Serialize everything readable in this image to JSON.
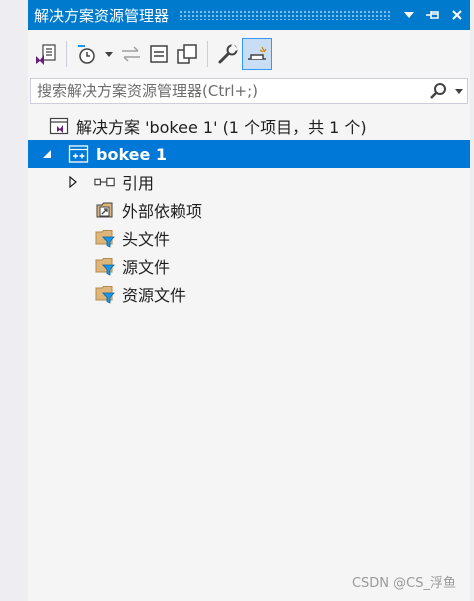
{
  "titlebar": {
    "title": "解决方案资源管理器",
    "dropdown_icon": "chevron-down-icon",
    "pin_icon": "pin-icon",
    "close_icon": "close-icon"
  },
  "toolbar": {
    "icons": [
      "vs-solution-switch-icon",
      "history-icon",
      "history-dropdown-icon",
      "sync-icon",
      "collapse-all-icon",
      "show-all-files-icon",
      "properties-wrench-icon",
      "preview-selected-icon"
    ]
  },
  "search": {
    "placeholder": "搜索解决方案资源管理器(Ctrl+;)",
    "value": ""
  },
  "tree": {
    "solution": "解决方案 'bokee 1' (1 个项目，共 1 个)",
    "project": "bokee 1",
    "items": [
      "引用",
      "外部依赖项",
      "头文件",
      "源文件",
      "资源文件"
    ]
  },
  "watermark": "CSDN @CS_浮鱼",
  "colors": {
    "accent": "#007acc",
    "selection": "#0078d7",
    "folder": "#dcb67a",
    "filter": "#1c97ea"
  }
}
